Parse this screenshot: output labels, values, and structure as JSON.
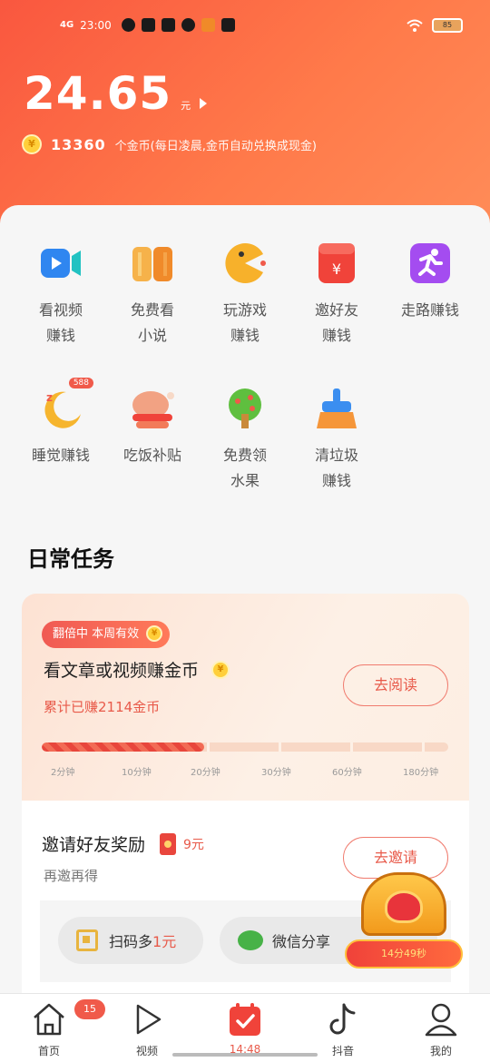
{
  "status_bar": {
    "network": "4G",
    "time": "23:00",
    "battery": "85"
  },
  "balance": {
    "amount": "24.65",
    "unit": "元"
  },
  "coins": {
    "count": "13360",
    "note": "个金币(每日凌晨,金币自动兑换成现金)"
  },
  "grid": [
    {
      "label": "看视频\n赚钱",
      "icon": "video-camera-icon",
      "color": "#2f86f0"
    },
    {
      "label": "免费看\n小说",
      "icon": "open-book-icon",
      "color": "#f49a37"
    },
    {
      "label": "玩游戏\n赚钱",
      "icon": "pacman-icon",
      "color": "#f7b12b"
    },
    {
      "label": "邀好友\n赚钱",
      "icon": "red-envelope-icon",
      "color": "#f0433a"
    },
    {
      "label": "走路赚钱",
      "icon": "running-person-icon",
      "color": "#a44cf0"
    },
    {
      "label": "睡觉赚钱",
      "icon": "moon-sleep-icon",
      "color": "#f6b52e",
      "badge": "588"
    },
    {
      "label": "吃饭补贴",
      "icon": "roast-chicken-icon",
      "color": "#f2724a"
    },
    {
      "label": "免费领\n水果",
      "icon": "fruit-tree-icon",
      "color": "#5fbf3f"
    },
    {
      "label": "清垃圾\n赚钱",
      "icon": "broom-icon",
      "color": "#3b8ef0"
    }
  ],
  "daily_tasks": {
    "title": "日常任务",
    "read_task": {
      "tag": "翻倍中 本周有效",
      "title": "看文章或视频赚金币",
      "earned": "累计已赚2114金币",
      "button": "去阅读",
      "progress_fraction": 0.4,
      "ticks": [
        "2分钟",
        "10分钟",
        "20分钟",
        "30分钟",
        "60分钟",
        "180分钟"
      ]
    },
    "invite_task": {
      "title": "邀请好友奖励",
      "reward": "9元",
      "subtitle": "再邀再得",
      "button": "去邀请",
      "share_qr_prefix": "扫码多",
      "share_qr_highlight": "1元",
      "share_wechat": "微信分享"
    }
  },
  "treasure_chest": {
    "timer": "14分49秒"
  },
  "tabbar": [
    {
      "label": "首页",
      "icon": "home-icon",
      "badge": "15"
    },
    {
      "label": "视频",
      "icon": "play-icon"
    },
    {
      "label": "14:48",
      "icon": "calendar-check-icon",
      "active": true
    },
    {
      "label": "抖音",
      "icon": "tiktok-icon"
    },
    {
      "label": "我的",
      "icon": "person-icon"
    }
  ],
  "colors": {
    "accent": "#e85a4a",
    "hero_start": "#f9573f",
    "hero_end": "#ff8d59"
  }
}
